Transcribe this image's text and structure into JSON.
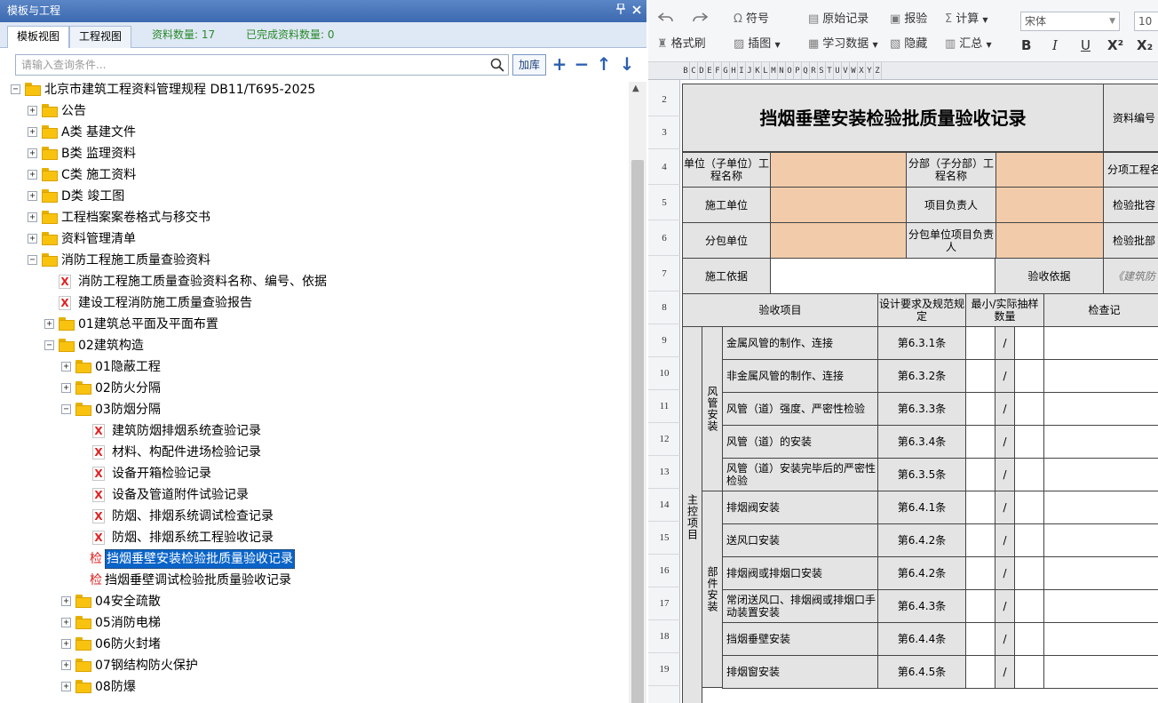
{
  "panel": {
    "title": "模板与工程",
    "pin_icon": "pin-icon",
    "close_icon": "close-icon",
    "tabs": [
      {
        "label": "模板视图"
      },
      {
        "label": "工程视图"
      }
    ],
    "count_label": "资料数量: 17",
    "done_label": "已完成资料数量: 0",
    "search_placeholder": "请输入查询条件...",
    "lib_button": "加库",
    "tools": [
      "+",
      "−",
      "↑",
      "↓"
    ]
  },
  "tree": [
    {
      "label": "北京市建筑工程资料管理规程 DB11/T695-2025",
      "kind": "folder",
      "level": 0,
      "exp": "−"
    },
    {
      "label": "公告",
      "kind": "folder",
      "level": 1,
      "exp": "+"
    },
    {
      "label": "A类 基建文件",
      "kind": "folder",
      "level": 1,
      "exp": "+"
    },
    {
      "label": "B类 监理资料",
      "kind": "folder",
      "level": 1,
      "exp": "+"
    },
    {
      "label": "C类 施工资料",
      "kind": "folder",
      "level": 1,
      "exp": "+"
    },
    {
      "label": "D类 竣工图",
      "kind": "folder",
      "level": 1,
      "exp": "+"
    },
    {
      "label": "工程档案案卷格式与移交书",
      "kind": "folder",
      "level": 1,
      "exp": "+"
    },
    {
      "label": "资料管理清单",
      "kind": "folder",
      "level": 1,
      "exp": "+"
    },
    {
      "label": "消防工程施工质量查验资料",
      "kind": "folder",
      "level": 1,
      "exp": "−"
    },
    {
      "label": "消防工程施工质量查验资料名称、编号、依据",
      "kind": "doc",
      "level": 2
    },
    {
      "label": "建设工程消防施工质量查验报告",
      "kind": "doc",
      "level": 2
    },
    {
      "label": "01建筑总平面及平面布置",
      "kind": "folder",
      "level": 2,
      "exp": "+"
    },
    {
      "label": "02建筑构造",
      "kind": "folder",
      "level": 2,
      "exp": "−"
    },
    {
      "label": "01隐蔽工程",
      "kind": "folder",
      "level": 3,
      "exp": "+"
    },
    {
      "label": "02防火分隔",
      "kind": "folder",
      "level": 3,
      "exp": "+"
    },
    {
      "label": "03防烟分隔",
      "kind": "folder",
      "level": 3,
      "exp": "−"
    },
    {
      "label": "建筑防烟排烟系统查验记录",
      "kind": "doc",
      "level": 4
    },
    {
      "label": "材料、构配件进场检验记录",
      "kind": "doc",
      "level": 4
    },
    {
      "label": "设备开箱检验记录",
      "kind": "doc",
      "level": 4
    },
    {
      "label": "设备及管道附件试验记录",
      "kind": "doc",
      "level": 4
    },
    {
      "label": "防烟、排烟系统调试检查记录",
      "kind": "doc",
      "level": 4
    },
    {
      "label": "防烟、排烟系统工程验收记录",
      "kind": "doc",
      "level": 4
    },
    {
      "label": "挡烟垂壁安装检验批质量验收记录",
      "kind": "jian",
      "level": 4,
      "selected": true
    },
    {
      "label": "挡烟垂壁调试检验批质量验收记录",
      "kind": "jian",
      "level": 4
    },
    {
      "label": "04安全疏散",
      "kind": "folder",
      "level": 3,
      "exp": "+"
    },
    {
      "label": "05消防电梯",
      "kind": "folder",
      "level": 3,
      "exp": "+"
    },
    {
      "label": "06防火封堵",
      "kind": "folder",
      "level": 3,
      "exp": "+"
    },
    {
      "label": "07钢结构防火保护",
      "kind": "folder",
      "level": 3,
      "exp": "+"
    },
    {
      "label": "08防爆",
      "kind": "folder",
      "level": 3,
      "exp": "+"
    }
  ],
  "jian_glyph": "检",
  "doc_glyph": "X",
  "toolbar": {
    "symbol": "符号",
    "raw_record": "原始记录",
    "report": "报验",
    "calc": "计算",
    "format_painter": "格式刷",
    "insert_image": "插图",
    "study_data": "学习数据",
    "hide": "隐藏",
    "summary": "汇总",
    "font": "宋体",
    "font_size": "10",
    "bold": "B",
    "italic": "I",
    "underline": "U",
    "superscript": "X²",
    "subscript": "X₂"
  },
  "col_letters": [
    "B",
    "C",
    "D",
    "E",
    "F",
    "G",
    "H",
    "I",
    "J",
    "K",
    "L",
    "M",
    "N",
    "O",
    "P",
    "Q",
    "R",
    "S",
    "T",
    "U",
    "V",
    "W",
    "X",
    "Y",
    "Z"
  ],
  "rows": [
    "2",
    "3",
    "4",
    "5",
    "6",
    "7",
    "8",
    "9",
    "10",
    "11",
    "12",
    "13",
    "14",
    "15",
    "16",
    "17",
    "18",
    "19"
  ],
  "sheet": {
    "title": "挡烟垂壁安装检验批质量验收记录",
    "doc_no_label": "资料编号",
    "unit_name_label": "单位（子单位）工程名称",
    "sub_name_label": "分部（子分部）工程名称",
    "item_name_label": "分项工程名",
    "construction_unit": "施工单位",
    "project_lead": "项目负责人",
    "batch_capacity": "检验批容",
    "sub_unit": "分包单位",
    "sub_lead": "分包单位项目负责人",
    "batch_part": "检验批部",
    "basis": "施工依据",
    "accept_basis": "验收依据",
    "accept_basis_val": "《建筑防",
    "col_item": "验收项目",
    "col_req": "设计要求及规范规定",
    "col_min": "最小/实际抽样数量",
    "col_check": "检查记",
    "group_main": "主控项目",
    "group_duct": "风管安装",
    "group_part": "部件安装",
    "slash": "/",
    "items": [
      {
        "name": "金属风管的制作、连接",
        "code": "第6.3.1条"
      },
      {
        "name": "非金属风管的制作、连接",
        "code": "第6.3.2条"
      },
      {
        "name": "风管（道）强度、严密性检验",
        "code": "第6.3.3条"
      },
      {
        "name": "风管（道）的安装",
        "code": "第6.3.4条"
      },
      {
        "name": "风管（道）安装完毕后的严密性检验",
        "code": "第6.3.5条"
      },
      {
        "name": "排烟阀安装",
        "code": "第6.4.1条"
      },
      {
        "name": "送风口安装",
        "code": "第6.4.2条"
      },
      {
        "name": "排烟阀或排烟口安装",
        "code": "第6.4.2条"
      },
      {
        "name": "常闭送风口、排烟阀或排烟口手动装置安装",
        "code": "第6.4.3条"
      },
      {
        "name": "挡烟垂壁安装",
        "code": "第6.4.4条"
      },
      {
        "name": "排烟窗安装",
        "code": "第6.4.5条"
      }
    ]
  }
}
